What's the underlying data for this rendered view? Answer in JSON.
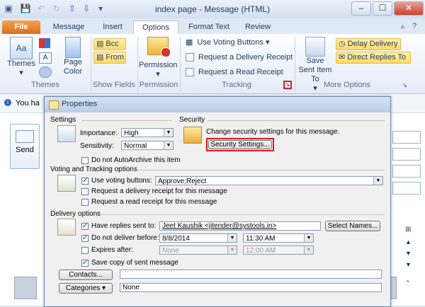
{
  "window": {
    "title": "index page - Message (HTML)"
  },
  "tabs": [
    {
      "label": "File"
    },
    {
      "label": "Message"
    },
    {
      "label": "Insert"
    },
    {
      "label": "Options"
    },
    {
      "label": "Format Text"
    },
    {
      "label": "Review"
    }
  ],
  "ribbon": {
    "themes": {
      "label": "Themes",
      "group": "Themes"
    },
    "page_color": {
      "label": "Page Color",
      "group": ""
    },
    "bcc": "Bcc",
    "from": "From",
    "show_fields_group": "Show Fields",
    "permission": {
      "label": "Permission",
      "group": "Permission"
    },
    "use_voting": "Use Voting Buttons",
    "request_delivery": "Request a Delivery Receipt",
    "request_read": "Request a Read Receipt",
    "tracking_group": "Tracking",
    "save_sent": "Save Sent Item To",
    "delay_delivery": "Delay Delivery",
    "direct_replies": "Direct Replies To",
    "more_options_group": "More Options"
  },
  "behind": {
    "you_have": "You ha",
    "send": "Send"
  },
  "dialog": {
    "title": "Properties",
    "settings": {
      "heading": "Settings",
      "importance_label": "Importance:",
      "importance_value": "High",
      "sensitivity_label": "Sensitivity:",
      "sensitivity_value": "Normal",
      "autoarchive": "Do not AutoArchive this item"
    },
    "security": {
      "heading": "Security",
      "text": "Change security settings for this message.",
      "button": "Security Settings..."
    },
    "voting": {
      "heading": "Voting and Tracking options",
      "use_voting": "Use voting buttons:",
      "voting_value": "Approve;Reject",
      "delivery_receipt": "Request a delivery receipt for this message",
      "read_receipt": "Request a read receipt for this message"
    },
    "delivery": {
      "heading": "Delivery options",
      "replies_label": "Have replies sent to:",
      "replies_value": "Jeet Kaushik <jitender@systools.in>",
      "select_names": "Select Names...",
      "not_before_label": "Do not deliver before:",
      "not_before_date": "8/8/2014",
      "not_before_time": "11:30 AM",
      "expires_label": "Expires after:",
      "expires_date": "None",
      "expires_time": "12:00 AM",
      "save_copy": "Save copy of sent message"
    },
    "contacts_button": "Contacts...",
    "categories_button": "Categories",
    "categories_value": "None"
  }
}
